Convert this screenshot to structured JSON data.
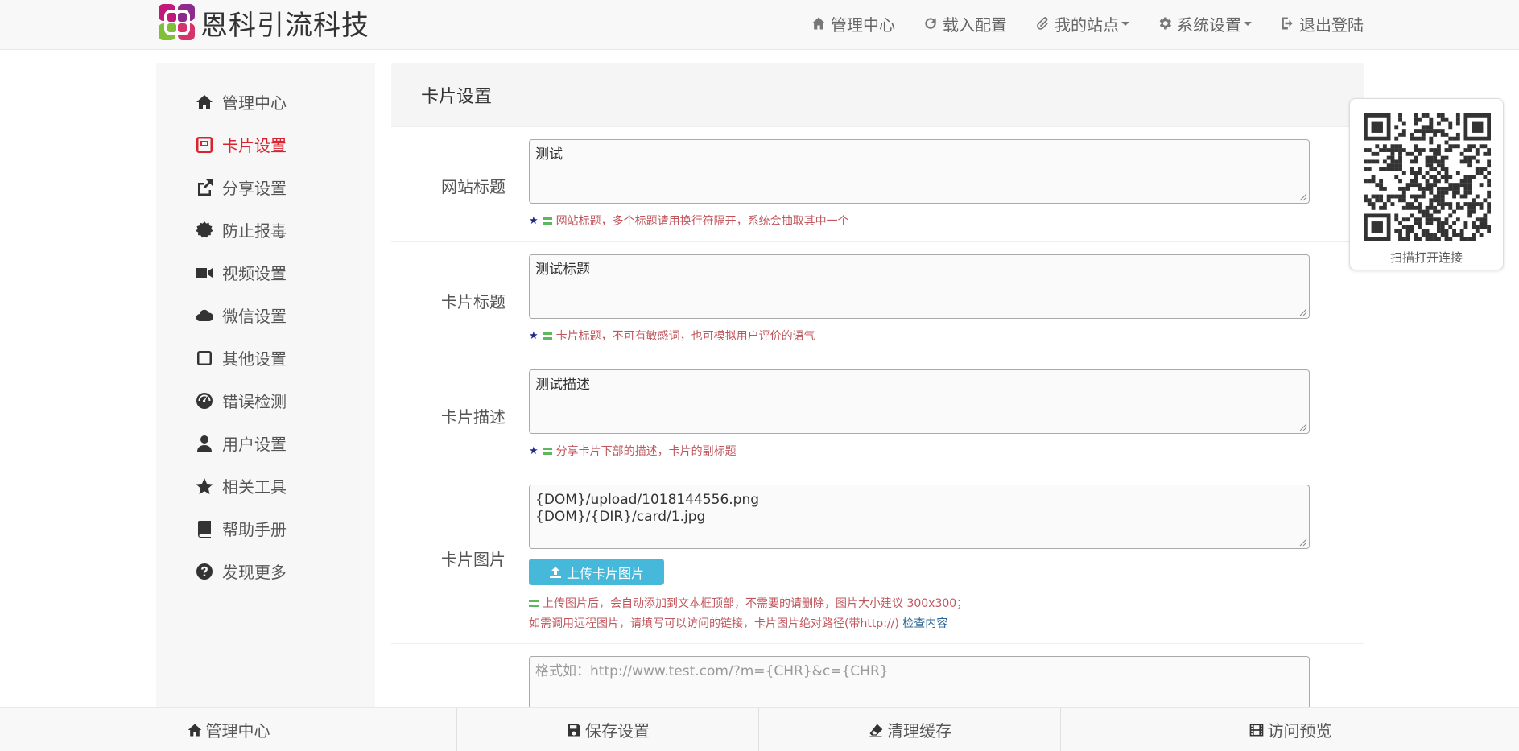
{
  "brand": {
    "name": "恩科引流科技"
  },
  "topnav": {
    "items": [
      {
        "label": "管理中心",
        "icon": "home-icon"
      },
      {
        "label": "载入配置",
        "icon": "refresh-icon"
      },
      {
        "label": "我的站点",
        "icon": "paperclip-icon"
      },
      {
        "label": "系统设置",
        "icon": "gear-icon"
      },
      {
        "label": "退出登陆",
        "icon": "logout-icon"
      }
    ]
  },
  "sidebar": {
    "items": [
      {
        "label": "管理中心",
        "icon": "home-icon"
      },
      {
        "label": "卡片设置",
        "icon": "card-icon",
        "active": true
      },
      {
        "label": "分享设置",
        "icon": "share-icon"
      },
      {
        "label": "防止报毒",
        "icon": "certificate-icon"
      },
      {
        "label": "视频设置",
        "icon": "video-icon"
      },
      {
        "label": "微信设置",
        "icon": "cloud-icon"
      },
      {
        "label": "其他设置",
        "icon": "square-icon"
      },
      {
        "label": "错误检测",
        "icon": "dashboard-icon"
      },
      {
        "label": "用户设置",
        "icon": "user-icon"
      },
      {
        "label": "相关工具",
        "icon": "star-icon"
      },
      {
        "label": "帮助手册",
        "icon": "book-icon"
      },
      {
        "label": "发现更多",
        "icon": "question-icon"
      }
    ]
  },
  "panel": {
    "title": "卡片设置",
    "fields": {
      "site_title": {
        "label": "网站标题",
        "value": "测试",
        "hint": "网站标题，多个标题请用换行符隔开，系统会抽取其中一个"
      },
      "card_title": {
        "label": "卡片标题",
        "value": "测试标题",
        "hint": "卡片标题，不可有敏感词，也可模拟用户评价的语气"
      },
      "card_desc": {
        "label": "卡片描述",
        "value": "测试描述",
        "hint": "分享卡片下部的描述，卡片的副标题"
      },
      "card_image": {
        "label": "卡片图片",
        "value": "{DOM}/upload/1018144556.png\n{DOM}/{DIR}/card/1.jpg",
        "upload_label": "上传卡片图片",
        "hint": "上传图片后，会自动添加到文本框顶部，不需要的请删除，图片大小建议 300x300；",
        "hint2": "如需调用远程图片，请填写可以访问的链接，卡片图片绝对路径(带http://)",
        "check_link": "检查内容"
      },
      "link_format": {
        "placeholder": "格式如：http://www.test.com/?m={CHR}&c={CHR}"
      }
    }
  },
  "qr": {
    "caption": "扫描打开连接"
  },
  "bottombar": {
    "items": [
      {
        "label": "管理中心",
        "icon": "home-icon"
      },
      {
        "label": "保存设置",
        "icon": "floppy-icon"
      },
      {
        "label": "清理缓存",
        "icon": "eraser-icon"
      },
      {
        "label": "访问预览",
        "icon": "film-icon"
      }
    ]
  },
  "colors": {
    "accent_active": "#d9232e",
    "upload_button": "#46b8da",
    "hint_text": "#c0565c"
  }
}
